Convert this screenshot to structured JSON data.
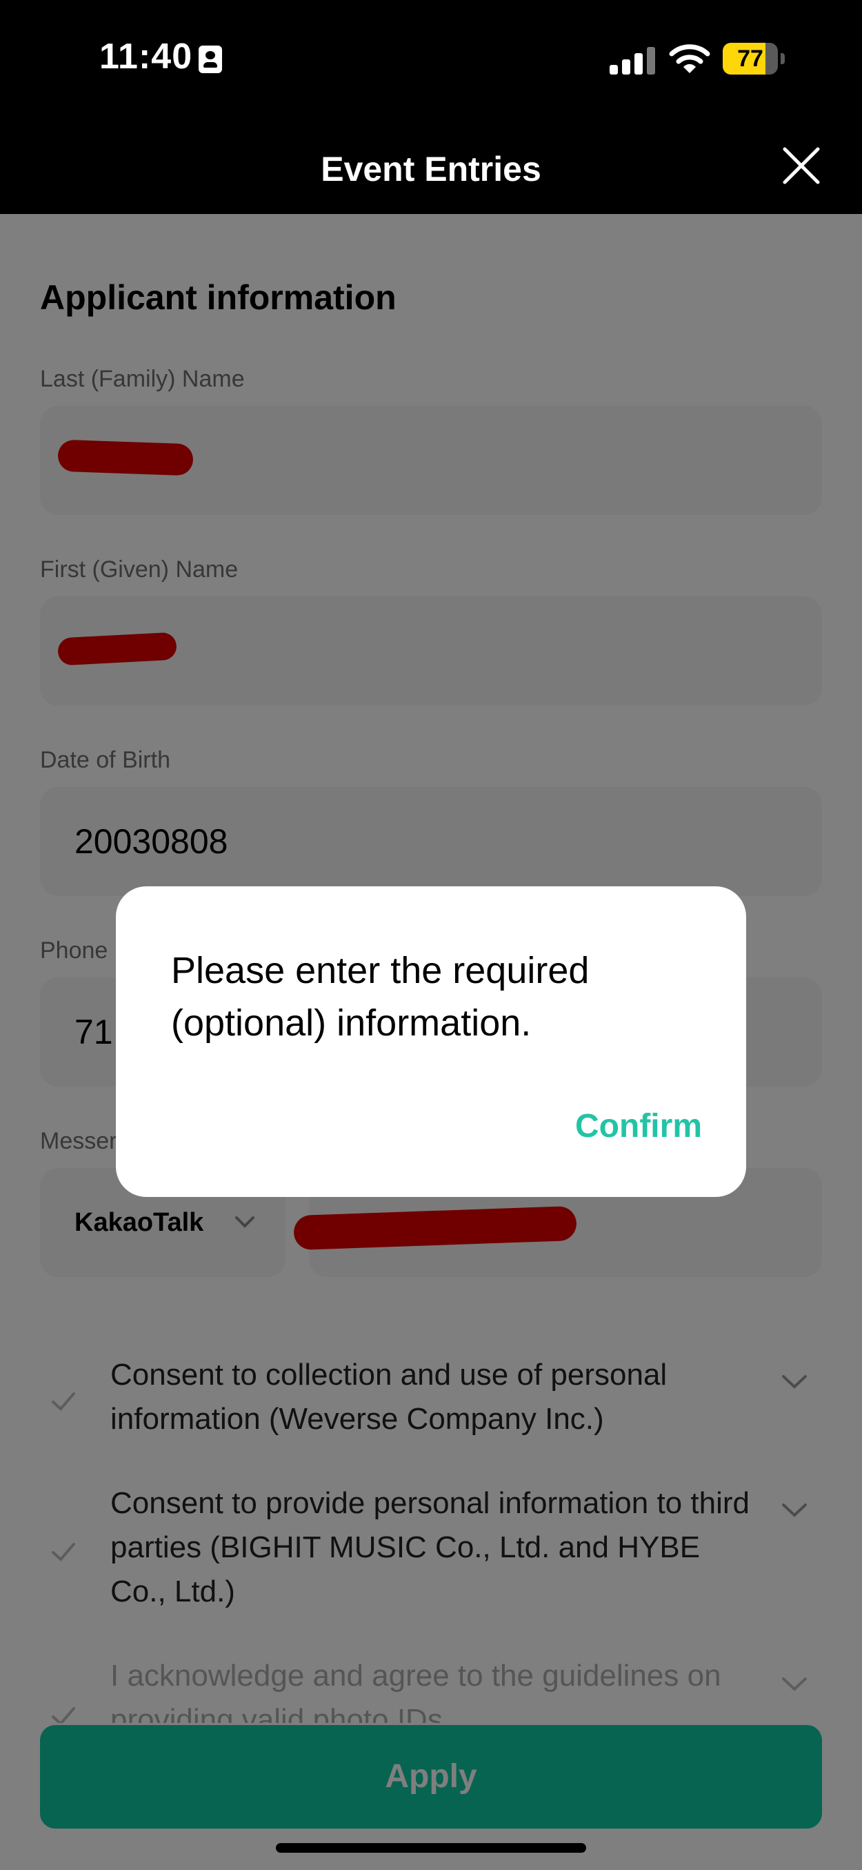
{
  "status_bar": {
    "time": "11:40",
    "battery_level": "77",
    "battery_fraction": 0.77,
    "battery_color": "#ffd60a",
    "icons": [
      "id-card-icon",
      "cellular-signal-icon",
      "wifi-icon",
      "battery-icon"
    ]
  },
  "header": {
    "title": "Event Entries",
    "close_icon": "close-icon"
  },
  "form": {
    "section_title": "Applicant information",
    "last_name": {
      "label": "Last (Family) Name",
      "value": ""
    },
    "first_name": {
      "label": "First (Given) Name",
      "value": ""
    },
    "dob": {
      "label": "Date of Birth",
      "value": "20030808"
    },
    "phone": {
      "label": "Phone",
      "value": "71"
    },
    "messenger": {
      "label": "Messer",
      "app": "KakaoTalk",
      "id": ""
    }
  },
  "consents": [
    {
      "text": "Consent to collection and use of personal information (Weverse Company Inc.)"
    },
    {
      "text": "Consent to provide personal information to third parties (BIGHIT MUSIC Co., Ltd. and HYBE Co., Ltd.)"
    },
    {
      "text": "I acknowledge and agree to the guidelines on providing valid photo IDs"
    }
  ],
  "apply_label": "Apply",
  "dialog": {
    "message": "Please enter the required (optional) information.",
    "confirm_label": "Confirm"
  },
  "colors": {
    "accent": "#0ec8a2",
    "confirm": "#22c4a4",
    "header_bg": "#000000",
    "field_bg": "#f4f5f7"
  }
}
